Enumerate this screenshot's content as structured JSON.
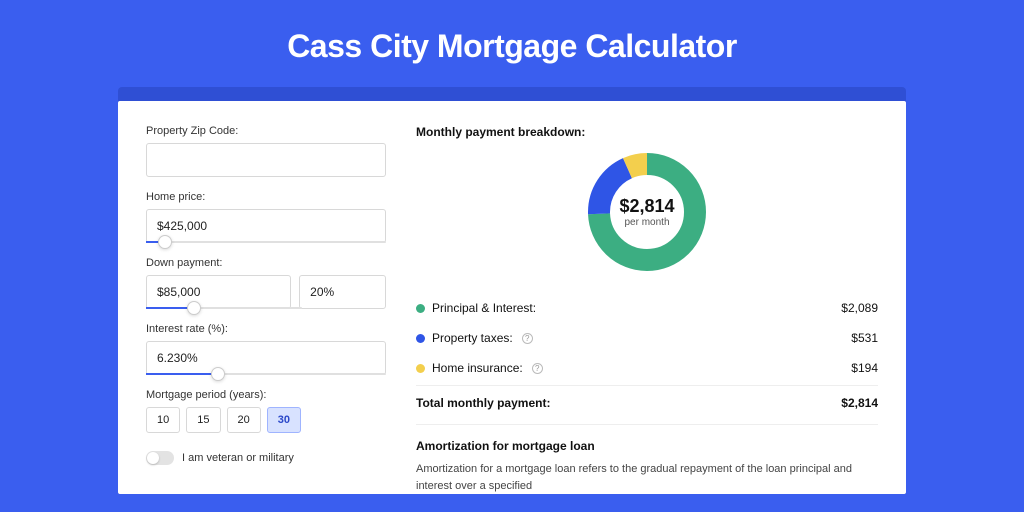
{
  "title": "Cass City Mortgage Calculator",
  "form": {
    "zip": {
      "label": "Property Zip Code:",
      "value": ""
    },
    "price": {
      "label": "Home price:",
      "value": "$425,000",
      "slider_pct": 8
    },
    "down": {
      "label": "Down payment:",
      "amount": "$85,000",
      "pct": "20%",
      "slider_pct": 20
    },
    "rate": {
      "label": "Interest rate (%):",
      "value": "6.230%",
      "slider_pct": 30
    },
    "period": {
      "label": "Mortgage period (years):",
      "options": [
        "10",
        "15",
        "20",
        "30"
      ],
      "active": "30"
    },
    "veteran": {
      "label": "I am veteran or military",
      "on": false
    }
  },
  "breakdown": {
    "title": "Monthly payment breakdown:",
    "center_amount": "$2,814",
    "center_sub": "per month",
    "items": [
      {
        "label": "Principal & Interest:",
        "value": "$2,089",
        "color": "#3cae82",
        "info": false
      },
      {
        "label": "Property taxes:",
        "value": "$531",
        "color": "#2f55e6",
        "info": true
      },
      {
        "label": "Home insurance:",
        "value": "$194",
        "color": "#f3cf4d",
        "info": true
      }
    ],
    "total": {
      "label": "Total monthly payment:",
      "value": "$2,814"
    }
  },
  "amortization": {
    "title": "Amortization for mortgage loan",
    "text": "Amortization for a mortgage loan refers to the gradual repayment of the loan principal and interest over a specified"
  },
  "chart_data": {
    "type": "pie",
    "title": "Monthly payment breakdown",
    "series": [
      {
        "name": "Principal & Interest",
        "value": 2089,
        "color": "#3cae82"
      },
      {
        "name": "Property taxes",
        "value": 531,
        "color": "#2f55e6"
      },
      {
        "name": "Home insurance",
        "value": 194,
        "color": "#f3cf4d"
      }
    ],
    "total": 2814,
    "center_label": "$2,814 per month"
  }
}
